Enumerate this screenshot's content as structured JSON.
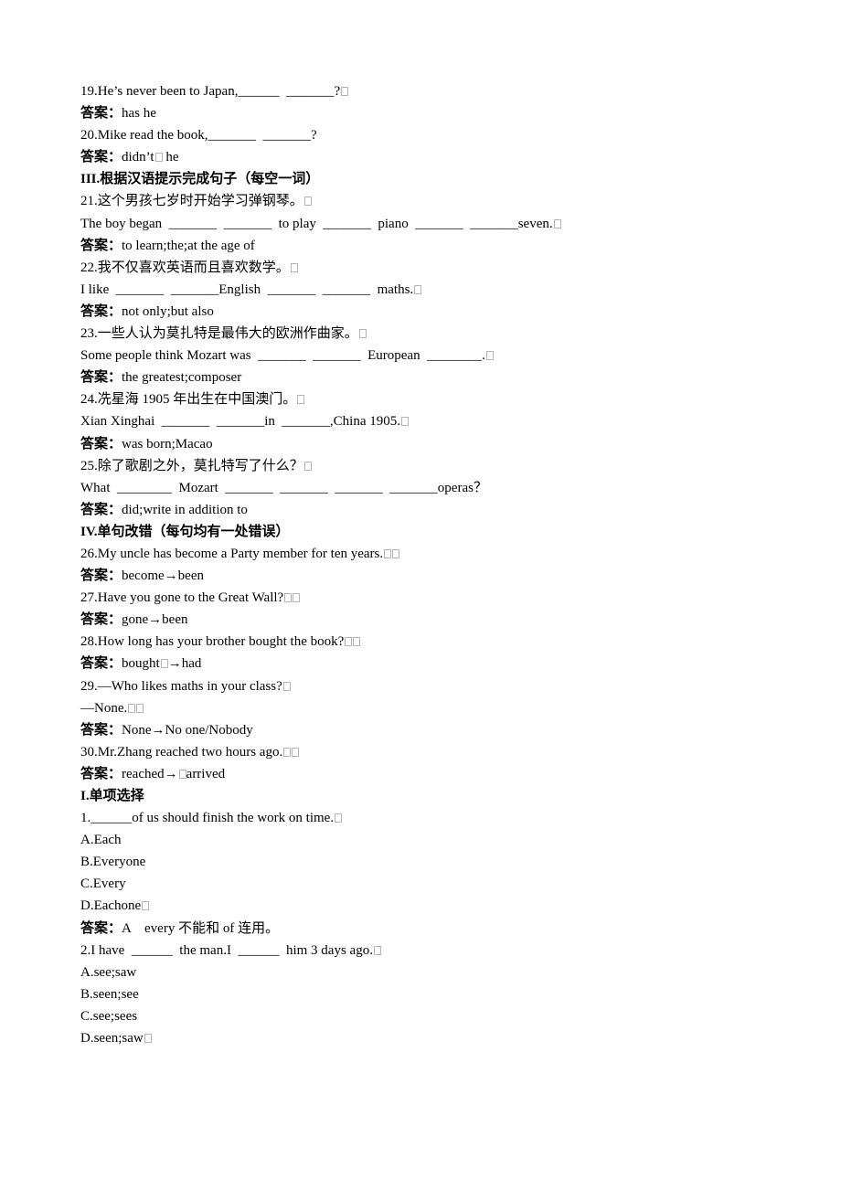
{
  "answer_label": "答案：",
  "lines": [
    {
      "type": "question",
      "text": "19.He’s never been to Japan,______  _______?",
      "boxes": 1
    },
    {
      "type": "answer",
      "text": "has he",
      "boxes": 0
    },
    {
      "type": "question",
      "text": "20.Mike read the book,_______  _______?",
      "boxes": 0
    },
    {
      "type": "answer",
      "text": "didn’t",
      "boxes": 1,
      "suffix": " he"
    },
    {
      "type": "heading",
      "text": "III.根据汉语提示完成句子（每空一词）",
      "boxes": 0
    },
    {
      "type": "question",
      "text": "21.这个男孩七岁时开始学习弹钢琴。",
      "boxes": 1
    },
    {
      "type": "question",
      "text": "The boy began  _______  _______  to play  _______  piano  _______  _______seven.",
      "boxes": 1
    },
    {
      "type": "answer",
      "text": "to learn;the;at the age of",
      "boxes": 0
    },
    {
      "type": "question",
      "text": "22.我不仅喜欢英语而且喜欢数学。",
      "boxes": 1
    },
    {
      "type": "question",
      "text": "I like  _______  _______English  _______  _______  maths.",
      "boxes": 1
    },
    {
      "type": "answer",
      "text": "not only;but also",
      "boxes": 0
    },
    {
      "type": "question",
      "text": "23.一些人认为莫扎特是最伟大的欧洲作曲家。",
      "boxes": 1
    },
    {
      "type": "question",
      "text": "Some people think Mozart was  _______  _______  European  ________.",
      "boxes": 1
    },
    {
      "type": "answer",
      "text": "the greatest;composer",
      "boxes": 0
    },
    {
      "type": "question",
      "text": "24.冼星海 1905 年出生在中国澳门。",
      "boxes": 1
    },
    {
      "type": "question",
      "text": "Xian Xinghai  _______  _______in  _______,China 1905.",
      "boxes": 1
    },
    {
      "type": "answer",
      "text": "was born;Macao",
      "boxes": 0
    },
    {
      "type": "question",
      "text": "25.除了歌剧之外，莫扎特写了什么？",
      "boxes": 1
    },
    {
      "type": "question",
      "text": "What  ________  Mozart  _______  _______  _______  _______operas？",
      "boxes": 0
    },
    {
      "type": "answer",
      "text": "did;write in addition to",
      "boxes": 0
    },
    {
      "type": "heading",
      "text": "IV.单句改错（每句均有一处错误）",
      "boxes": 0
    },
    {
      "type": "question",
      "text": "26.My uncle has become a Party member for ten years.",
      "boxes": 2
    },
    {
      "type": "answer",
      "text": "become→been",
      "boxes": 0
    },
    {
      "type": "question",
      "text": "27.Have you gone to the Great Wall?",
      "boxes": 2
    },
    {
      "type": "answer",
      "text": "gone→been",
      "boxes": 0
    },
    {
      "type": "question",
      "text": "28.How long has your brother bought the book?",
      "boxes": 2
    },
    {
      "type": "answer",
      "text": "bought",
      "boxes": 1,
      "suffix": "→had"
    },
    {
      "type": "question",
      "text": "29.—Who likes maths in your class?",
      "boxes": 1
    },
    {
      "type": "question",
      "text": "—None.",
      "boxes": 2
    },
    {
      "type": "answer",
      "text": "None→No one/Nobody",
      "boxes": 0
    },
    {
      "type": "question",
      "text": "30.Mr.Zhang reached two hours ago.",
      "boxes": 2
    },
    {
      "type": "answer",
      "text": "reached→",
      "boxes": 1,
      "suffix": "arrived"
    },
    {
      "type": "heading",
      "text": "I.单项选择",
      "boxes": 0
    },
    {
      "type": "question",
      "text": "1.______of us should finish the work on time.",
      "boxes": 1
    },
    {
      "type": "option",
      "text": "A.Each",
      "boxes": 0
    },
    {
      "type": "option",
      "text": "B.Everyone",
      "boxes": 0
    },
    {
      "type": "option",
      "text": "C.Every",
      "boxes": 0
    },
    {
      "type": "option",
      "text": "D.Eachone",
      "boxes": 1
    },
    {
      "type": "answer",
      "text": "A    every 不能和 of 连用。",
      "boxes": 0
    },
    {
      "type": "question",
      "text": "2.I have  ______  the man.I  ______  him 3 days ago.",
      "boxes": 1
    },
    {
      "type": "option",
      "text": "A.see;saw",
      "boxes": 0
    },
    {
      "type": "option",
      "text": "B.seen;see",
      "boxes": 0
    },
    {
      "type": "option",
      "text": "C.see;sees",
      "boxes": 0
    },
    {
      "type": "option",
      "text": "D.seen;saw",
      "boxes": 1
    }
  ]
}
